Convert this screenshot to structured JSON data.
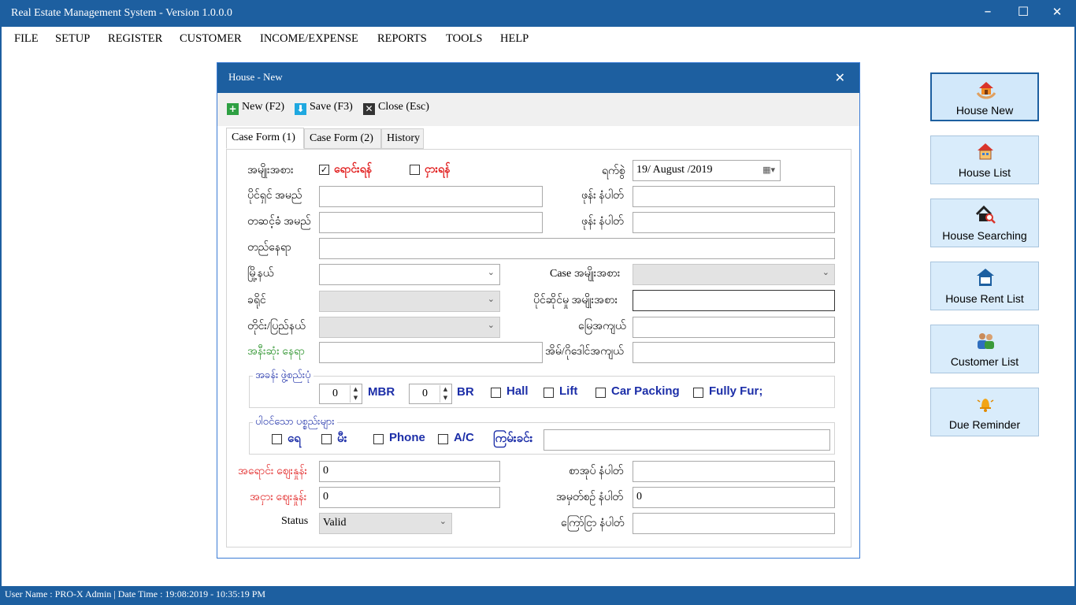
{
  "window": {
    "title": "Real Estate Management System - Version 1.0.0.0"
  },
  "menu": [
    "FILE",
    "SETUP",
    "REGISTER",
    "CUSTOMER",
    "INCOME/EXPENSE",
    "REPORTS",
    "TOOLS",
    "HELP"
  ],
  "dialog": {
    "title": "House - New",
    "toolbar": {
      "new": "New (F2)",
      "save": "Save (F3)",
      "close": "Close (Esc)"
    },
    "tabs": [
      "Case Form (1)",
      "Case Form (2)",
      "History"
    ],
    "form": {
      "type_label": "အမျိုးအစား",
      "sale_label": "ရောင်းရန်",
      "rent_label": "ငှားရန်",
      "date_label": "ရက်စွဲ",
      "date_value": "19/   August   /2019",
      "owner_name_label": "ပိုင်ရှင် အမည်",
      "phone1_label": "ဖုန်း နံပါတ်",
      "contact_name_label": "တဆင့်ခံ အမည်",
      "phone2_label": "ဖုန်း နံပါတ်",
      "address_label": "တည်နေရာ",
      "township_label": "မြို့နယ်",
      "case_type_label": "Case အမျိုးအစား",
      "district_label": "ခရိုင်",
      "ownership_type_label": "ပိုင်ဆိုင်မှု အမျိုးအစား",
      "region_label": "တိုင်း/ပြည်နယ်",
      "land_area_label": "မြေအကျယ်",
      "nearby_label": "အနီးဆုံး နေရာ",
      "house_area_label": "အိမ်/ဂိုဒေါင်အကျယ်",
      "room_group_label": "အခန်း ဖွဲ့စည်းပုံ",
      "mbr_value": "0",
      "mbr_label": "MBR",
      "br_value": "0",
      "br_label": "BR",
      "hall_label": "Hall",
      "lift_label": "Lift",
      "car_parking_label": "Car Packing",
      "fully_furnished_label": "Fully Fur;",
      "included_group_label": "ပါဝင်သော ပစ္စည်းများ",
      "water_label": "ရေ",
      "electric_label": "မီး",
      "phone_label": "Phone",
      "ac_label": "A/C",
      "remark_label": "ကြမ်းခင်း",
      "sale_price_label": "အရောင်း ဈေးနှုန်း",
      "sale_price_value": "0",
      "rent_price_label": "အငှား ဈေးနှုန်း",
      "rent_price_value": "0",
      "doc_no_label": "စာအုပ် နံပါတ်",
      "reg_no_label": "အမှတ်စဉ် နံပါတ်",
      "reg_no_value": "0",
      "ad_no_label": "ကြော်ငြာ နံပါတ်",
      "status_label": "Status",
      "status_value": "Valid"
    }
  },
  "side_buttons": [
    {
      "label": "House New",
      "icon": "house-hands-icon"
    },
    {
      "label": "House List",
      "icon": "house-list-icon"
    },
    {
      "label": "House Searching",
      "icon": "house-search-icon"
    },
    {
      "label": "House Rent List",
      "icon": "for-rent-icon"
    },
    {
      "label": "Customer List",
      "icon": "customers-icon"
    },
    {
      "label": "Due Reminder",
      "icon": "bell-icon"
    }
  ],
  "status_bar": "User Name : PRO-X Admin   |  Date Time : 19:08:2019 - 10:35:19 PM",
  "colors": {
    "frame": "#1d5fa0",
    "accent_red": "#e01818",
    "accent_blue": "#1c2ea8",
    "side_button": "#d9ecfb"
  }
}
